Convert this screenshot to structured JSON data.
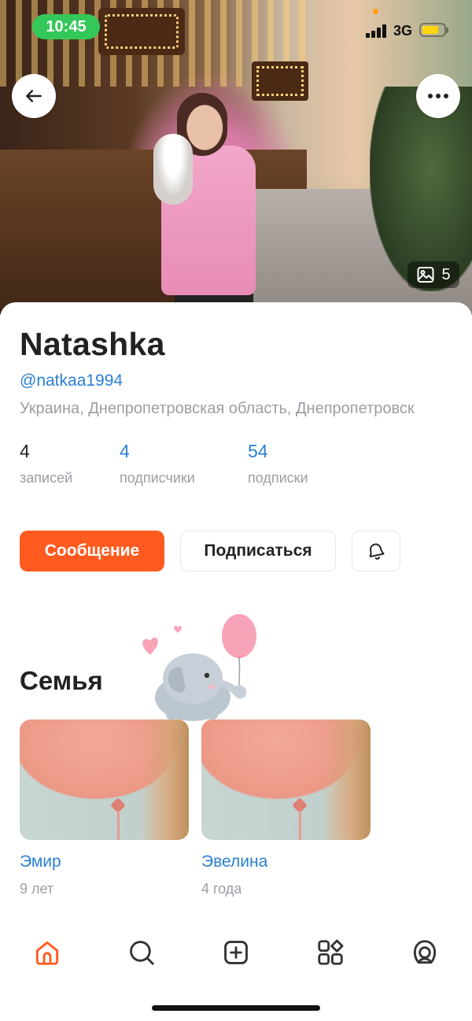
{
  "status_bar": {
    "time": "10:45",
    "network": "3G"
  },
  "profile": {
    "name": "Natashka",
    "handle": "@natkaa1994",
    "location": "Украина, Днепропетровская область, Днепропетровск",
    "photo_count": "5"
  },
  "stats": [
    {
      "value": "4",
      "label": "записей"
    },
    {
      "value": "4",
      "label": "подписчики"
    },
    {
      "value": "54",
      "label": "подписки"
    }
  ],
  "actions": {
    "message": "Сообщение",
    "subscribe": "Подписаться"
  },
  "family": {
    "title": "Семья",
    "members": [
      {
        "name": "Эмир",
        "age": "9 лет"
      },
      {
        "name": "Эвелина",
        "age": "4 года"
      }
    ]
  },
  "tabs": [
    "home-icon",
    "search-icon",
    "add-post-icon",
    "services-icon",
    "profile-icon"
  ],
  "colors": {
    "accent": "#ff5a1f",
    "link": "#2a7fd4",
    "muted": "#9a9ea4",
    "status_green": "#34c759"
  }
}
